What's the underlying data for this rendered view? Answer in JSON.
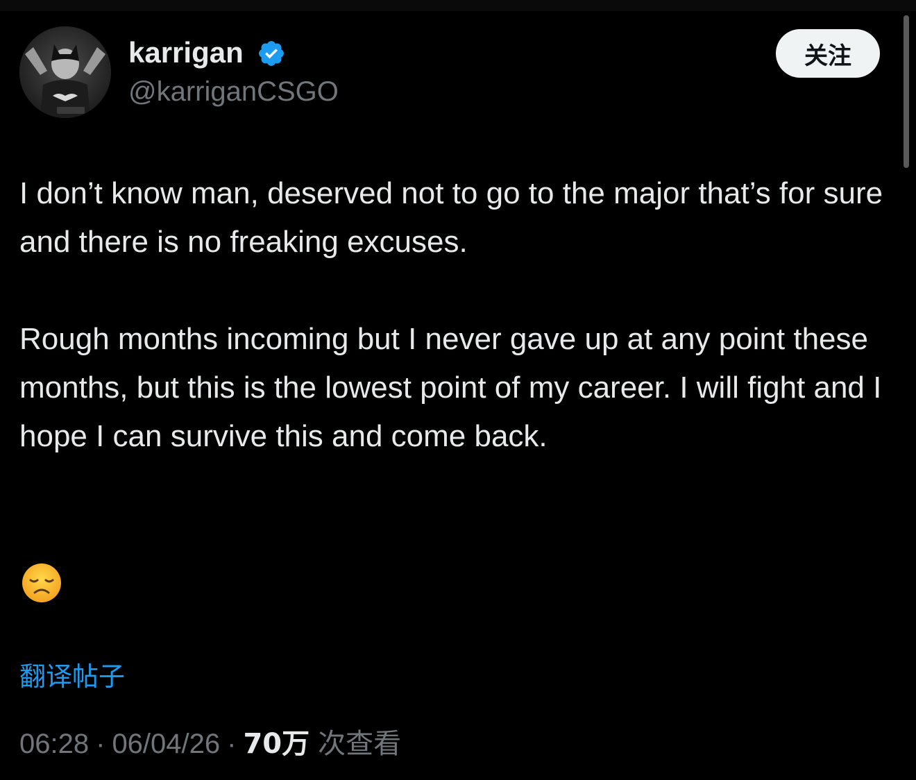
{
  "author": {
    "display_name": "karrigan",
    "handle": "@karriganCSGO",
    "verified": true,
    "avatar_icon": "avatar-photo-batman",
    "verified_color": "#1d9bf0"
  },
  "follow_button": {
    "label": "关注"
  },
  "tweet": {
    "paragraph_1": "I don’t know man, deserved not to go to the major that’s for sure and there is no freaking excuses.",
    "paragraph_2": "Rough months incoming but I never gave up at any point these months, but this is the lowest point of my career. I will fight and I hope I can survive this and come back.",
    "emoji": "disappointed-face-emoji"
  },
  "translate_link": {
    "label": "翻译帖子",
    "color": "#1d9bf0"
  },
  "meta": {
    "time": "06:28",
    "separator": "·",
    "date": "06/04/26",
    "views_count": "70万",
    "views_label": "次查看"
  }
}
